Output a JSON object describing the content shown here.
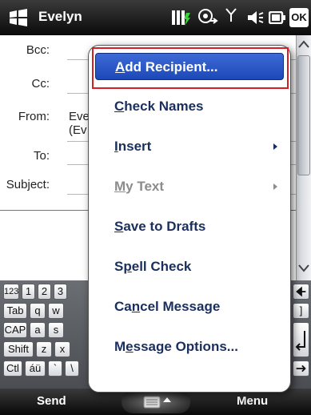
{
  "titlebar": {
    "title": "Evelyn",
    "start_icon": "windows-flag-icon",
    "status_icons": [
      "battery-charging-icon",
      "connectivity-icon",
      "signal-icon",
      "volume-icon",
      "power-icon"
    ],
    "ok_label": "OK"
  },
  "form": {
    "fields": [
      {
        "label": "Bcc:",
        "value": ""
      },
      {
        "label": "Cc:",
        "value": ""
      },
      {
        "label": "From:",
        "value": "Eve",
        "value2": "(Ev"
      },
      {
        "label": "To:",
        "value": ""
      },
      {
        "label": "Subject:",
        "value": ""
      }
    ]
  },
  "menu": {
    "items": [
      {
        "label": "Add Recipient...",
        "access_key": "A",
        "selected": true,
        "enabled": true,
        "submenu": false
      },
      {
        "label": "Check Names",
        "access_key": "C",
        "selected": false,
        "enabled": true,
        "submenu": false
      },
      {
        "label": "Insert",
        "access_key": "I",
        "selected": false,
        "enabled": true,
        "submenu": true
      },
      {
        "label": "My Text",
        "access_key": "M",
        "selected": false,
        "enabled": false,
        "submenu": true
      },
      {
        "label": "Save to Drafts",
        "access_key": "S",
        "selected": false,
        "enabled": true,
        "submenu": false
      },
      {
        "label": "Spell Check",
        "access_key": "p",
        "selected": false,
        "enabled": true,
        "submenu": false
      },
      {
        "label": "Cancel Message",
        "access_key": "n",
        "selected": false,
        "enabled": true,
        "submenu": false
      },
      {
        "label": "Message Options...",
        "access_key": "e",
        "selected": false,
        "enabled": true,
        "submenu": false
      }
    ]
  },
  "keyboard": {
    "row1": [
      "123",
      "1",
      "2",
      "3"
    ],
    "row2": [
      "Tab",
      "q",
      "w"
    ],
    "row3": [
      "CAP",
      "a",
      "s"
    ],
    "row4": [
      "Shift",
      "z",
      "x"
    ],
    "row5": [
      "Ctl",
      "áü",
      "`",
      "\\"
    ],
    "right_keys": [
      "]"
    ]
  },
  "softkeys": {
    "left": "Send",
    "right": "Menu",
    "sip_icon": "keyboard-icon"
  },
  "colors": {
    "menu_text": "#1a2f5e",
    "selected_bg": "#2a58c8",
    "highlight_border": "#d41f27",
    "disabled_text": "#8c8c8c"
  }
}
